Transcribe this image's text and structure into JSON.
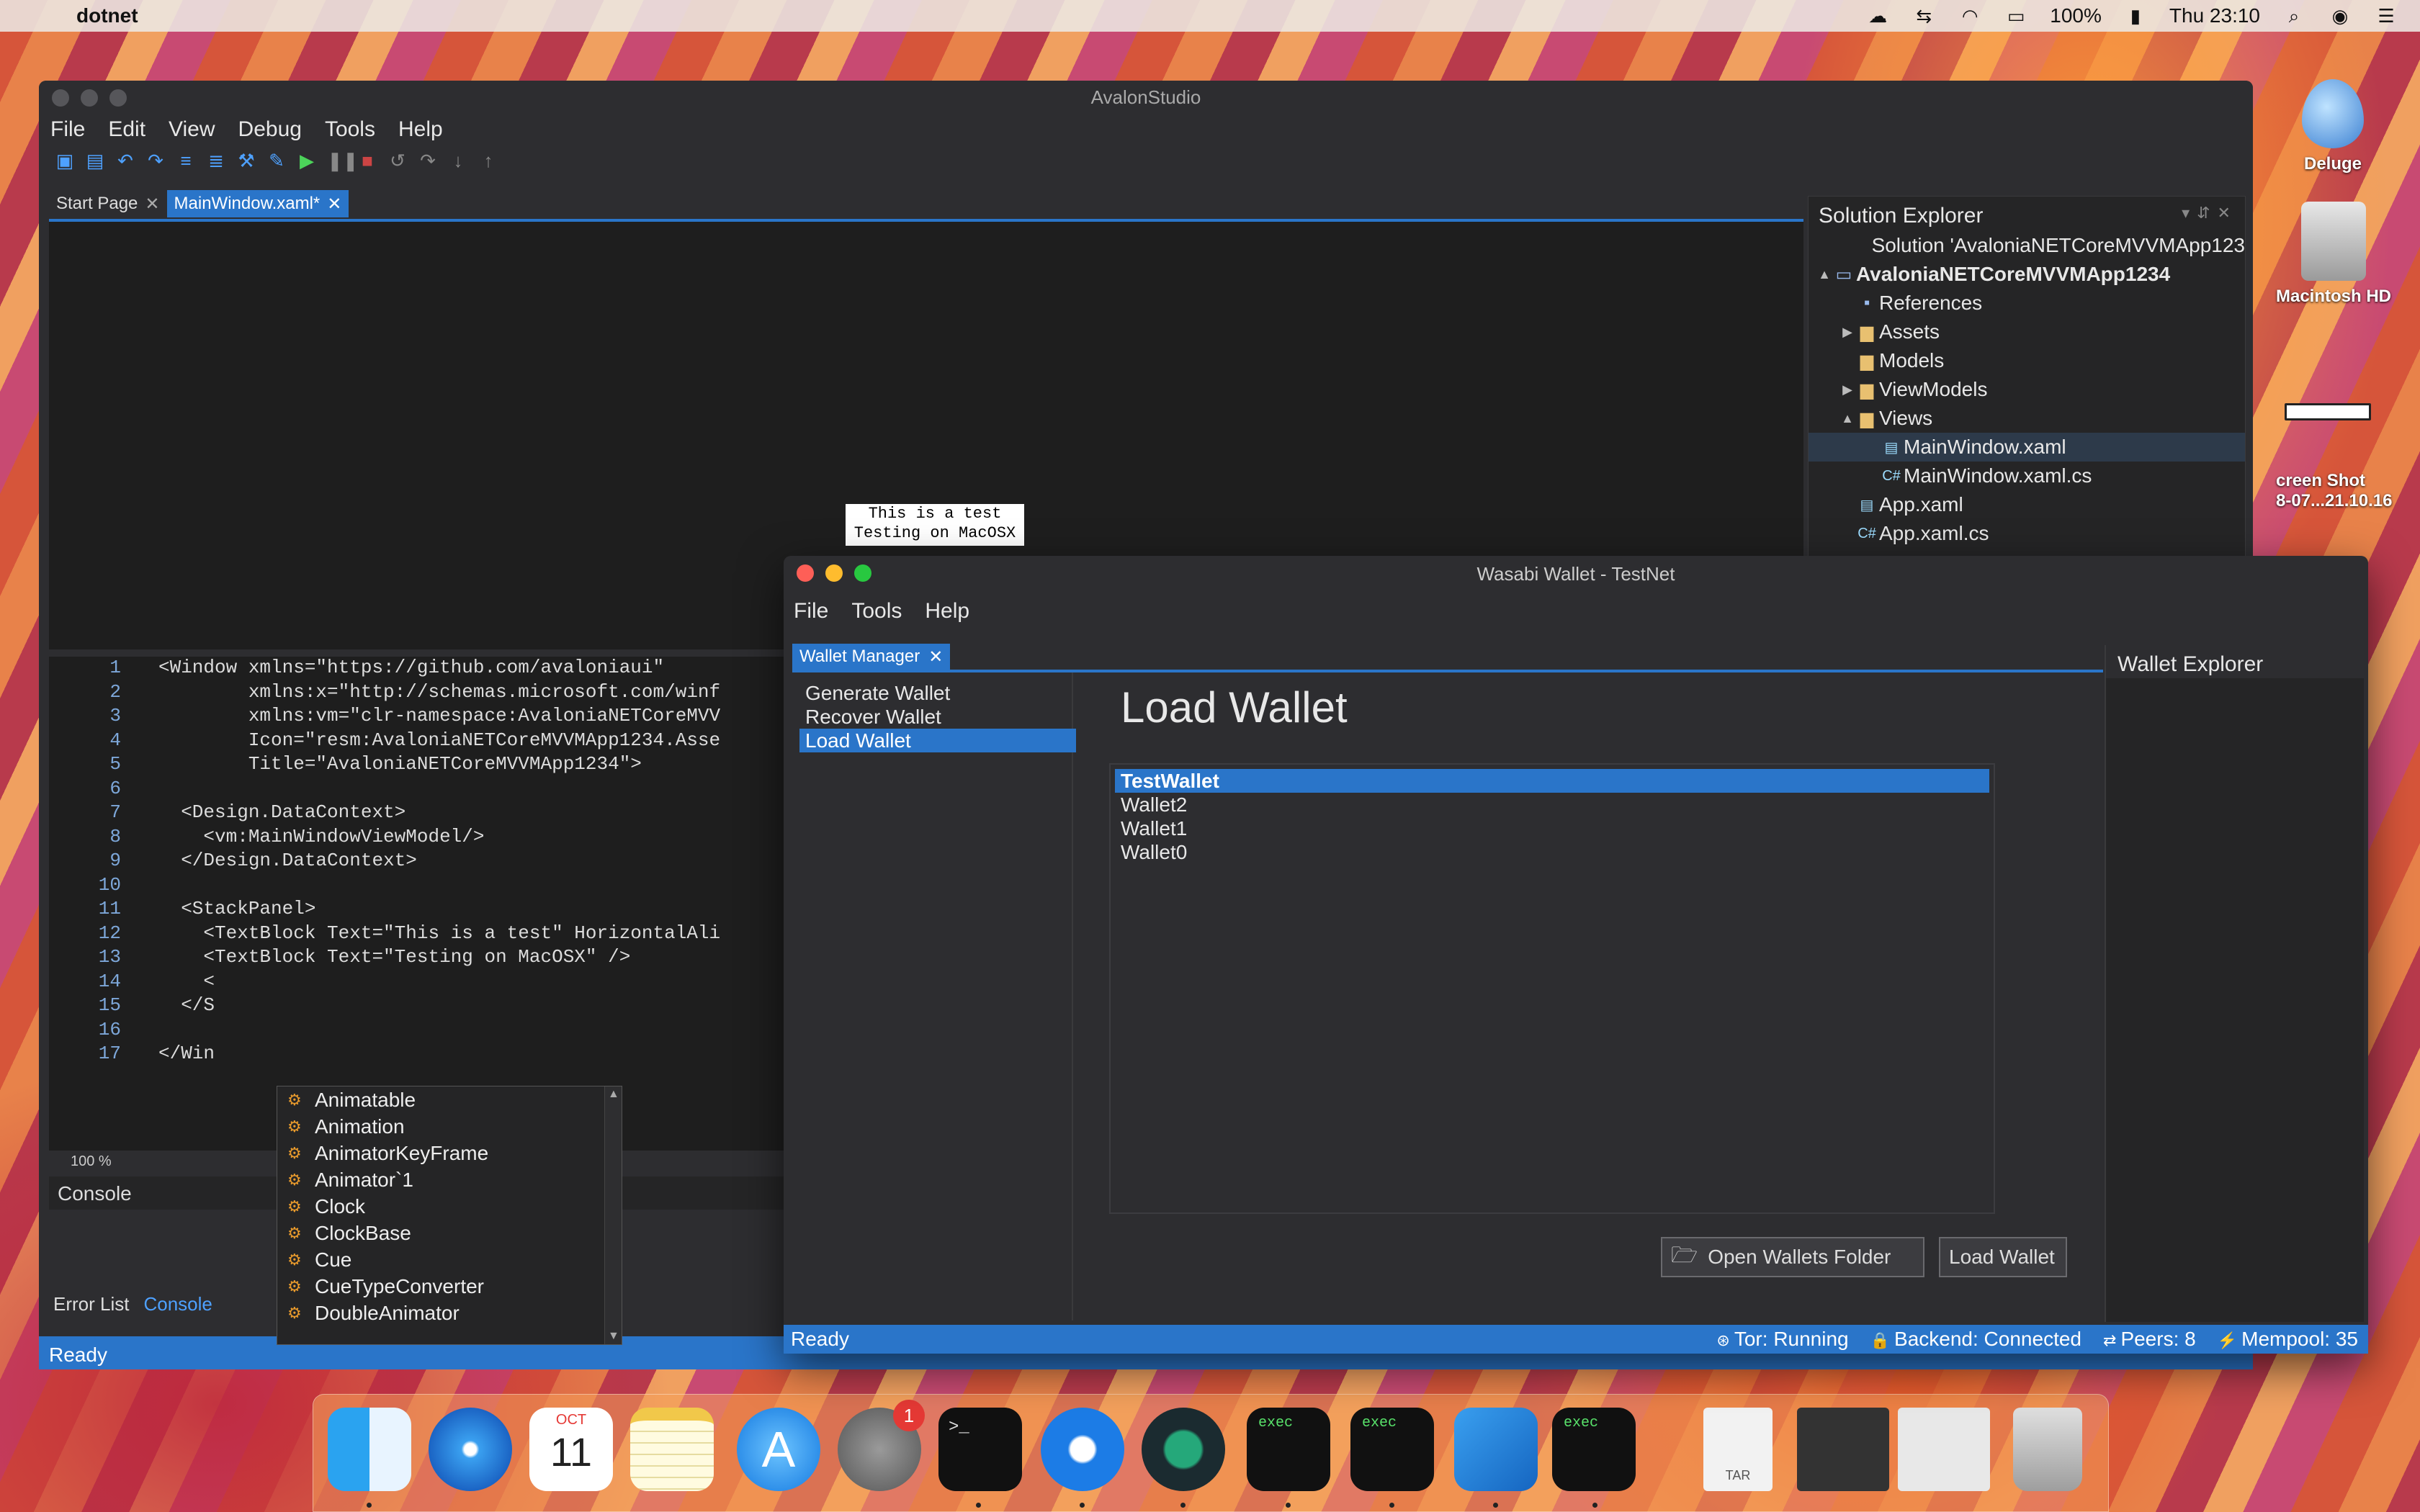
{
  "menubar": {
    "app": "dotnet",
    "battery": "100%",
    "clock": "Thu 23:10"
  },
  "avalon": {
    "title": "AvalonStudio",
    "menu": [
      "File",
      "Edit",
      "View",
      "Debug",
      "Tools",
      "Help"
    ],
    "tabs": [
      "Start Page",
      "MainWindow.xaml*"
    ],
    "preview_lines": [
      "This is a test",
      "Testing on MacOSX"
    ],
    "zoom": "100 %",
    "console_title": "Console",
    "console_tabs": [
      "Error List",
      "Console"
    ],
    "status": "Ready",
    "code": [
      {
        "n": "1",
        "t": "<Window xmlns=\"https://github.com/avaloniaui\""
      },
      {
        "n": "2",
        "t": "        xmlns:x=\"http://schemas.microsoft.com/winf"
      },
      {
        "n": "3",
        "t": "        xmlns:vm=\"clr-namespace:AvaloniaNETCoreMVV"
      },
      {
        "n": "4",
        "t": "        Icon=\"resm:AvaloniaNETCoreMVVMApp1234.Asse"
      },
      {
        "n": "5",
        "t": "        Title=\"AvaloniaNETCoreMVVMApp1234\">"
      },
      {
        "n": "6",
        "t": ""
      },
      {
        "n": "7",
        "t": "  <Design.DataContext>"
      },
      {
        "n": "8",
        "t": "    <vm:MainWindowViewModel/>"
      },
      {
        "n": "9",
        "t": "  </Design.DataContext>"
      },
      {
        "n": "10",
        "t": ""
      },
      {
        "n": "11",
        "t": "  <StackPanel>"
      },
      {
        "n": "12",
        "t": "    <TextBlock Text=\"This is a test\" HorizontalAli"
      },
      {
        "n": "13",
        "t": "    <TextBlock Text=\"Testing on MacOSX\" />"
      },
      {
        "n": "14",
        "t": "    <"
      },
      {
        "n": "15",
        "t": "  </S"
      },
      {
        "n": "16",
        "t": ""
      },
      {
        "n": "17",
        "t": "</Win"
      }
    ],
    "completion": [
      "Animatable",
      "Animation",
      "AnimatorKeyFrame",
      "Animator`1",
      "Clock",
      "ClockBase",
      "Cue",
      "CueTypeConverter",
      "DoubleAnimator"
    ],
    "solution_explorer": {
      "title": "Solution Explorer",
      "items": [
        {
          "label": "Solution 'AvaloniaNETCoreMVVMApp123",
          "icon": "solution-icon",
          "indent": 0,
          "arrow": ""
        },
        {
          "label": "AvaloniaNETCoreMVVMApp1234",
          "icon": "project-icon",
          "indent": 0,
          "arrow": "▲",
          "bold": true
        },
        {
          "label": "References",
          "icon": "references-icon",
          "indent": 1,
          "arrow": ""
        },
        {
          "label": "Assets",
          "icon": "folder-icon",
          "indent": 1,
          "arrow": "▶"
        },
        {
          "label": "Models",
          "icon": "folder-icon",
          "indent": 1,
          "arrow": ""
        },
        {
          "label": "ViewModels",
          "icon": "folder-icon",
          "indent": 1,
          "arrow": "▶"
        },
        {
          "label": "Views",
          "icon": "folder-open-icon",
          "indent": 1,
          "arrow": "▲"
        },
        {
          "label": "MainWindow.xaml",
          "icon": "xaml-file-icon",
          "indent": 2,
          "arrow": "",
          "selected": true
        },
        {
          "label": "MainWindow.xaml.cs",
          "icon": "cs-file-icon",
          "indent": 2,
          "arrow": ""
        },
        {
          "label": "App.xaml",
          "icon": "xaml-file-icon",
          "indent": 1,
          "arrow": ""
        },
        {
          "label": "App.xaml.cs",
          "icon": "cs-file-icon",
          "indent": 1,
          "arrow": ""
        }
      ]
    }
  },
  "wasabi": {
    "title": "Wasabi Wallet - TestNet",
    "menu": [
      "File",
      "Tools",
      "Help"
    ],
    "tab": "Wallet Manager",
    "nav": [
      "Generate Wallet",
      "Recover Wallet",
      "Load Wallet"
    ],
    "heading": "Load Wallet",
    "wallets": [
      "TestWallet",
      "Wallet2",
      "Wallet1",
      "Wallet0"
    ],
    "open_folder_button": "Open Wallets Folder",
    "load_button": "Load Wallet",
    "explorer_title": "Wallet Explorer",
    "status": "Ready",
    "tor": "Tor: Running",
    "backend": "Backend: Connected",
    "peers": "Peers: 8",
    "mempool": "Mempool: 35"
  },
  "desktop": {
    "deluge": "Deluge",
    "hd": "Macintosh HD",
    "screenshot_1": "creen Shot",
    "screenshot_2": "8-07...21.10.16"
  },
  "dock": {
    "calendar_month": "OCT",
    "calendar_day": "11",
    "exec_label": "exec",
    "tar_label": "TAR",
    "badge": "1"
  },
  "colors": {
    "accent": "#2a75c9",
    "window_bg": "#2d2d30"
  }
}
